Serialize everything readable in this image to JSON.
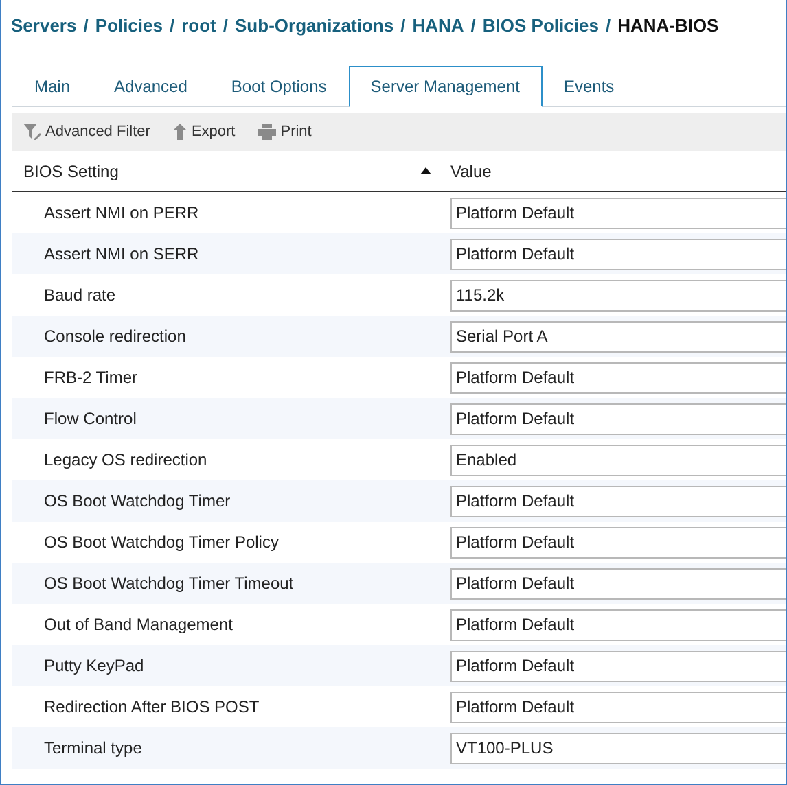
{
  "breadcrumb": [
    {
      "label": "Servers",
      "current": false,
      "separator": "/"
    },
    {
      "label": "Policies",
      "current": false,
      "separator": "/"
    },
    {
      "label": "root",
      "current": false,
      "separator": "/"
    },
    {
      "label": "Sub-Organizations",
      "current": false,
      "separator": "/"
    },
    {
      "label": "HANA",
      "current": false,
      "separator": "/"
    },
    {
      "label": "BIOS Policies",
      "current": false,
      "separator": "/"
    },
    {
      "label": "HANA-BIOS",
      "current": true
    }
  ],
  "tabs": [
    {
      "label": "Main",
      "selected": false
    },
    {
      "label": "Advanced",
      "selected": false
    },
    {
      "label": "Boot Options",
      "selected": false
    },
    {
      "label": "Server Management",
      "selected": true
    },
    {
      "label": "Events",
      "selected": false
    }
  ],
  "toolbar": [
    {
      "label": "Advanced Filter",
      "kind": "filter"
    },
    {
      "label": "Export",
      "kind": "export"
    },
    {
      "label": "Print",
      "kind": "print"
    }
  ],
  "table": {
    "columns": [
      {
        "label": "BIOS Setting",
        "sorted_ascending": true
      },
      {
        "label": "Value"
      }
    ],
    "rows": [
      {
        "setting": "Assert NMI on PERR",
        "value": "Platform Default"
      },
      {
        "setting": "Assert NMI on SERR",
        "value": "Platform Default"
      },
      {
        "setting": "Baud rate",
        "value": "115.2k"
      },
      {
        "setting": "Console redirection",
        "value": "Serial Port A"
      },
      {
        "setting": "FRB-2 Timer",
        "value": "Platform Default"
      },
      {
        "setting": "Flow Control",
        "value": "Platform Default"
      },
      {
        "setting": "Legacy OS redirection",
        "value": "Enabled"
      },
      {
        "setting": "OS Boot Watchdog Timer",
        "value": "Platform Default"
      },
      {
        "setting": "OS Boot Watchdog Timer Policy",
        "value": "Platform Default"
      },
      {
        "setting": "OS Boot Watchdog Timer Timeout",
        "value": "Platform Default"
      },
      {
        "setting": "Out of Band Management",
        "value": "Platform Default"
      },
      {
        "setting": "Putty KeyPad",
        "value": "Platform Default"
      },
      {
        "setting": "Redirection After BIOS POST",
        "value": "Platform Default"
      },
      {
        "setting": "Terminal type",
        "value": "VT100-PLUS"
      }
    ]
  }
}
